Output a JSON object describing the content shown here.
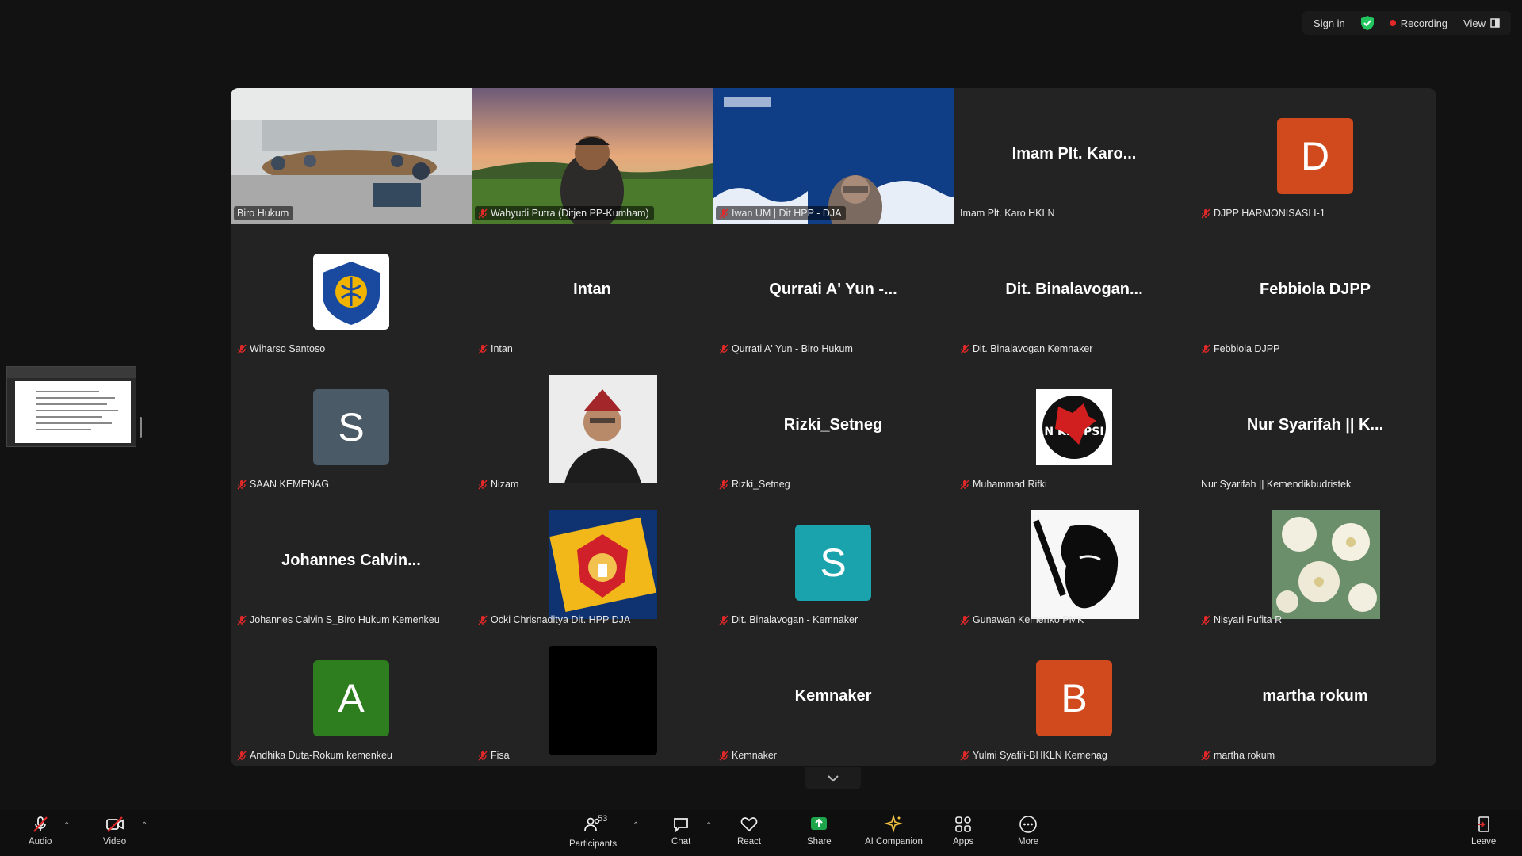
{
  "topbar": {
    "sign_in": "Sign in",
    "recording": "Recording",
    "view": "View"
  },
  "tiles": [
    {
      "name": "Biro Hukum",
      "type": "video",
      "muted": false,
      "active": true
    },
    {
      "name": "Wahyudi Putra (Ditjen PP-Kumham)",
      "type": "video",
      "muted": true
    },
    {
      "name": "Iwan UM | Dit HPP - DJA",
      "type": "video",
      "muted": true
    },
    {
      "name": "Imam Plt. Karo HKLN",
      "display": "Imam Plt. Karo...",
      "type": "name",
      "muted": false
    },
    {
      "name": "DJPP HARMONISASI I-1",
      "type": "avatar",
      "letter": "D",
      "color": "#d14a1e",
      "muted": true
    },
    {
      "name": "Wiharso Santoso",
      "type": "logo",
      "muted": true
    },
    {
      "name": "Intan",
      "display": "Intan",
      "type": "name",
      "muted": true
    },
    {
      "name": "Qurrati A' Yun - Biro Hukum",
      "display": "Qurrati A' Yun -...",
      "type": "name",
      "muted": true
    },
    {
      "name": "Dit. Binalavogan Kemnaker",
      "display": "Dit. Binalavogan...",
      "type": "name",
      "muted": true
    },
    {
      "name": "Febbiola DJPP",
      "display": "Febbiola DJPP",
      "type": "name",
      "muted": true
    },
    {
      "name": "SAAN KEMENAG",
      "type": "avatar",
      "letter": "S",
      "color": "#4a5a66",
      "muted": true
    },
    {
      "name": "Nizam",
      "type": "photo-person",
      "muted": true
    },
    {
      "name": "Rizki_Setneg",
      "display": "Rizki_Setneg",
      "type": "name",
      "muted": true
    },
    {
      "name": "Muhammad Rifki",
      "type": "photo-korupsi",
      "muted": true
    },
    {
      "name": "Nur Syarifah || Kemendikbudristek",
      "display": "Nur Syarifah || K...",
      "type": "name",
      "muted": false
    },
    {
      "name": "Johannes Calvin S_Biro Hukum Kemenkeu",
      "display": "Johannes  Calvin...",
      "type": "name",
      "muted": true
    },
    {
      "name": "Ocki Chrisnaditya Dit. HPP DJA",
      "type": "photo-garuda",
      "muted": true
    },
    {
      "name": "Dit. Binalavogan - Kemnaker",
      "type": "avatar",
      "letter": "S",
      "color": "#1aa3ad",
      "muted": true
    },
    {
      "name": "Gunawan Kemenko PMK",
      "type": "photo-bw",
      "muted": true
    },
    {
      "name": "Nisyari Pufita R",
      "type": "photo-flower",
      "muted": true
    },
    {
      "name": "Andhika Duta-Rokum kemenkeu",
      "type": "avatar",
      "letter": "A",
      "color": "#2e7d1e",
      "muted": true
    },
    {
      "name": "Fisa",
      "type": "photo-black",
      "muted": true
    },
    {
      "name": "Kemnaker",
      "display": "Kemnaker",
      "type": "name",
      "muted": true
    },
    {
      "name": "Yulmi Syafi'i-BHKLN Kemenag",
      "type": "avatar",
      "letter": "B",
      "color": "#d14a1e",
      "muted": true
    },
    {
      "name": "martha rokum",
      "display": "martha rokum",
      "type": "name",
      "muted": true
    }
  ],
  "toolbar": {
    "audio": "Audio",
    "video": "Video",
    "participants": "Participants",
    "participants_count": "53",
    "chat": "Chat",
    "react": "React",
    "share": "Share",
    "ai_companion": "AI Companion",
    "apps": "Apps",
    "more": "More",
    "leave": "Leave"
  },
  "colors": {
    "accent_green": "#22c55e",
    "muted_red": "#e02828",
    "share_green": "#1ea54b"
  }
}
